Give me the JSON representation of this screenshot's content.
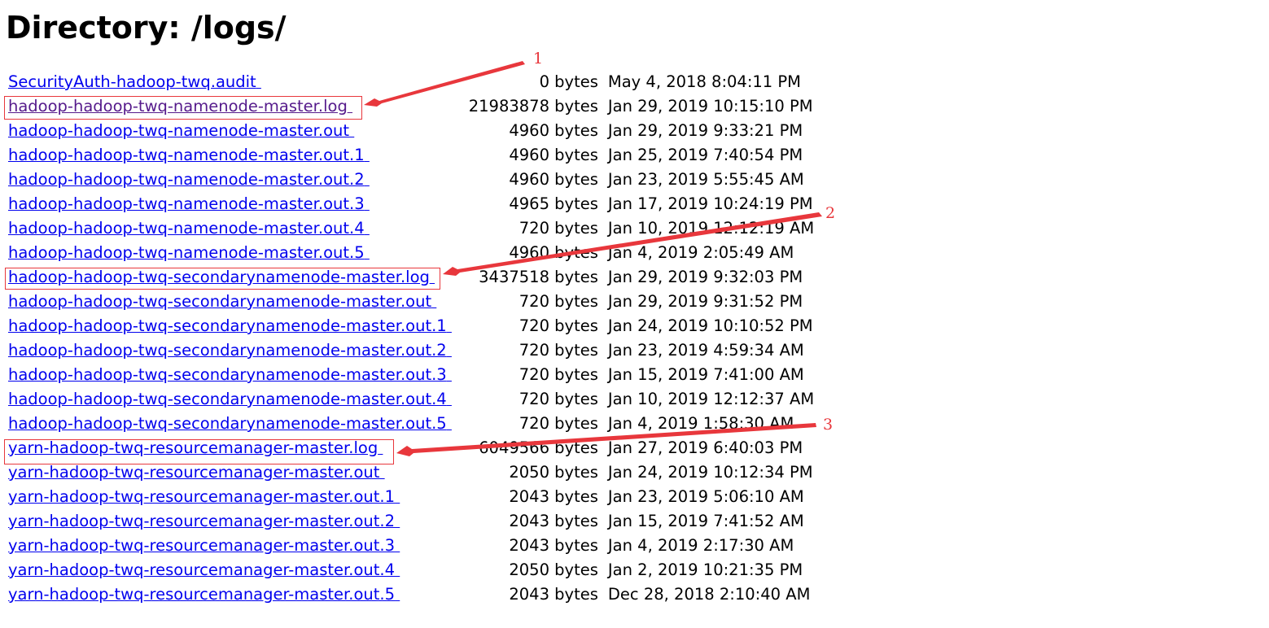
{
  "page": {
    "title": "Directory: /logs/"
  },
  "files": [
    {
      "name": "SecurityAuth-hadoop-twq.audit",
      "size": "0 bytes",
      "modified": "May 4, 2018 8:04:11 PM",
      "visited": false
    },
    {
      "name": "hadoop-hadoop-twq-namenode-master.log",
      "size": "21983878 bytes",
      "modified": "Jan 29, 2019 10:15:10 PM",
      "visited": true
    },
    {
      "name": "hadoop-hadoop-twq-namenode-master.out",
      "size": "4960 bytes",
      "modified": "Jan 29, 2019 9:33:21 PM",
      "visited": false
    },
    {
      "name": "hadoop-hadoop-twq-namenode-master.out.1",
      "size": "4960 bytes",
      "modified": "Jan 25, 2019 7:40:54 PM",
      "visited": false
    },
    {
      "name": "hadoop-hadoop-twq-namenode-master.out.2",
      "size": "4960 bytes",
      "modified": "Jan 23, 2019 5:55:45 AM",
      "visited": false
    },
    {
      "name": "hadoop-hadoop-twq-namenode-master.out.3",
      "size": "4965 bytes",
      "modified": "Jan 17, 2019 10:24:19 PM",
      "visited": false
    },
    {
      "name": "hadoop-hadoop-twq-namenode-master.out.4",
      "size": "720 bytes",
      "modified": "Jan 10, 2019 12:12:19 AM",
      "visited": false
    },
    {
      "name": "hadoop-hadoop-twq-namenode-master.out.5",
      "size": "4960 bytes",
      "modified": "Jan 4, 2019 2:05:49 AM",
      "visited": false
    },
    {
      "name": "hadoop-hadoop-twq-secondarynamenode-master.log",
      "size": "3437518 bytes",
      "modified": "Jan 29, 2019 9:32:03 PM",
      "visited": false
    },
    {
      "name": "hadoop-hadoop-twq-secondarynamenode-master.out",
      "size": "720 bytes",
      "modified": "Jan 29, 2019 9:31:52 PM",
      "visited": false
    },
    {
      "name": "hadoop-hadoop-twq-secondarynamenode-master.out.1",
      "size": "720 bytes",
      "modified": "Jan 24, 2019 10:10:52 PM",
      "visited": false
    },
    {
      "name": "hadoop-hadoop-twq-secondarynamenode-master.out.2",
      "size": "720 bytes",
      "modified": "Jan 23, 2019 4:59:34 AM",
      "visited": false
    },
    {
      "name": "hadoop-hadoop-twq-secondarynamenode-master.out.3",
      "size": "720 bytes",
      "modified": "Jan 15, 2019 7:41:00 AM",
      "visited": false
    },
    {
      "name": "hadoop-hadoop-twq-secondarynamenode-master.out.4",
      "size": "720 bytes",
      "modified": "Jan 10, 2019 12:12:37 AM",
      "visited": false
    },
    {
      "name": "hadoop-hadoop-twq-secondarynamenode-master.out.5",
      "size": "720 bytes",
      "modified": "Jan 4, 2019 1:58:30 AM",
      "visited": false
    },
    {
      "name": "yarn-hadoop-twq-resourcemanager-master.log",
      "size": "6049566 bytes",
      "modified": "Jan 27, 2019 6:40:03 PM",
      "visited": false
    },
    {
      "name": "yarn-hadoop-twq-resourcemanager-master.out",
      "size": "2050 bytes",
      "modified": "Jan 24, 2019 10:12:34 PM",
      "visited": false
    },
    {
      "name": "yarn-hadoop-twq-resourcemanager-master.out.1",
      "size": "2043 bytes",
      "modified": "Jan 23, 2019 5:06:10 AM",
      "visited": false
    },
    {
      "name": "yarn-hadoop-twq-resourcemanager-master.out.2",
      "size": "2043 bytes",
      "modified": "Jan 15, 2019 7:41:52 AM",
      "visited": false
    },
    {
      "name": "yarn-hadoop-twq-resourcemanager-master.out.3",
      "size": "2043 bytes",
      "modified": "Jan 4, 2019 2:17:30 AM",
      "visited": false
    },
    {
      "name": "yarn-hadoop-twq-resourcemanager-master.out.4",
      "size": "2050 bytes",
      "modified": "Jan 2, 2019 10:21:35 PM",
      "visited": false
    },
    {
      "name": "yarn-hadoop-twq-resourcemanager-master.out.5",
      "size": "2043 bytes",
      "modified": "Dec 28, 2018 2:10:40 AM",
      "visited": false
    }
  ],
  "annotations": {
    "color": "#e8373c",
    "markers": [
      {
        "number": "1",
        "target": "hadoop-hadoop-twq-namenode-master.log"
      },
      {
        "number": "2",
        "target": "hadoop-hadoop-twq-secondarynamenode-master.log"
      },
      {
        "number": "3",
        "target": "yarn-hadoop-twq-resourcemanager-master.log"
      }
    ]
  },
  "colors": {
    "link": "#0000ee",
    "visited_link": "#551a8b",
    "background": "#ffffff"
  }
}
